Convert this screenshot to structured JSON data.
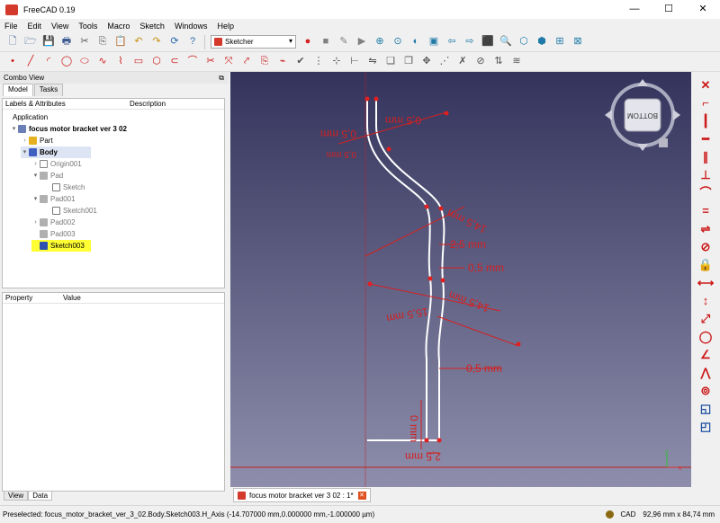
{
  "window": {
    "title": "FreeCAD 0.19",
    "minimize": "—",
    "maximize": "☐",
    "close": "✕"
  },
  "menu": [
    "File",
    "Edit",
    "View",
    "Tools",
    "Macro",
    "Sketch",
    "Windows",
    "Help"
  ],
  "workbench": {
    "selected": "Sketcher"
  },
  "toolbar1": {
    "icons_left": [
      "new-icon",
      "open-icon",
      "save-icon",
      "print-icon",
      "cut-icon",
      "copy-icon",
      "paste-icon",
      "undo-icon",
      "redo-icon",
      "refresh-icon",
      "whats-this-icon"
    ],
    "glyphs_left": [
      "🗋",
      "🗁",
      "💾",
      "🖶",
      "✂",
      "⎘",
      "📋",
      "↶",
      "↷",
      "⟳",
      "?"
    ],
    "icons_right": [
      "record-macro-icon",
      "stop-macro-icon",
      "edit-macro-icon",
      "run-macro-icon",
      "fit-all-icon",
      "fit-selection-icon",
      "draw-style-icon",
      "sync-view-icon",
      "back-icon",
      "forward-icon",
      "workbench-icon",
      "zoom-icon",
      "cube-view-icon",
      "part-icon",
      "measure-icon",
      "clipping-icon"
    ],
    "glyphs_right": [
      "●",
      "■",
      "✎",
      "▶",
      "⊕",
      "⊙",
      "◐",
      "▣",
      "⇦",
      "⇨",
      "⬛",
      "🔍",
      "⬡",
      "⬢",
      "⊞",
      "⊠"
    ]
  },
  "toolbar2": {
    "icons": [
      "point-icon",
      "line-icon",
      "arc-icon",
      "circle-icon",
      "conic-icon",
      "bspline-icon",
      "polyline-icon",
      "rectangle-icon",
      "polygon-icon",
      "slot-icon",
      "fillet-icon",
      "trim-icon",
      "extend-icon",
      "external-geometry-icon",
      "carbon-copy-icon",
      "construction-mode-icon",
      "validate-sketch-icon",
      "select-constraints-icon",
      "select-origin-icon",
      "select-axes-icon",
      "mirror-icon",
      "clone-icon",
      "copy-geometry-icon",
      "move-icon",
      "rectangular-array-icon",
      "delete-geometry-icon",
      "delete-constraints-icon",
      "toggle-driving-icon",
      "bspline-degree-icon"
    ],
    "glyphs": [
      "•",
      "╱",
      "◜",
      "◯",
      "⬭",
      "∿",
      "⌇",
      "▭",
      "⬡",
      "⊂",
      "⌒",
      "✂",
      "⤧",
      "⤤",
      "⎘",
      "⌁",
      "✔",
      "⋮",
      "⊹",
      "⊢",
      "⇋",
      "❏",
      "❐",
      "✥",
      "⋰",
      "✗",
      "⊘",
      "⇅",
      "≋"
    ]
  },
  "combo_view": {
    "header": "Combo View",
    "float_glyph": "⧉",
    "tabs": [
      "Model",
      "Tasks"
    ],
    "tree_columns": [
      "Labels & Attributes",
      "Description"
    ],
    "tree": [
      {
        "label": "Application",
        "arrow": "",
        "icon": "",
        "bold": false,
        "faded": false
      },
      {
        "label": "focus motor bracket ver 3 02",
        "arrow": "▾",
        "icon": "document-icon",
        "bold": true,
        "faded": false
      },
      {
        "label": "Part",
        "arrow": "›",
        "icon": "part-icon",
        "bold": false,
        "faded": false
      },
      {
        "label": "Body",
        "arrow": "▾",
        "icon": "body-icon",
        "bold": true,
        "faded": false,
        "highlight": true
      },
      {
        "label": "Origin001",
        "arrow": "›",
        "icon": "origin-icon",
        "bold": false,
        "faded": true
      },
      {
        "label": "Pad",
        "arrow": "▾",
        "icon": "pad-icon",
        "bold": false,
        "faded": true
      },
      {
        "label": "Sketch",
        "arrow": "",
        "icon": "sketch-icon",
        "bold": false,
        "faded": true
      },
      {
        "label": "Pad001",
        "arrow": "▾",
        "icon": "pad-icon",
        "bold": false,
        "faded": true
      },
      {
        "label": "Sketch001",
        "arrow": "",
        "icon": "sketch-icon",
        "bold": false,
        "faded": true
      },
      {
        "label": "Pad002",
        "arrow": "›",
        "icon": "pad-icon",
        "bold": false,
        "faded": true
      },
      {
        "label": "Pad003",
        "arrow": "",
        "icon": "pad-icon",
        "bold": false,
        "faded": true
      },
      {
        "label": "Sketch003",
        "arrow": "",
        "icon": "sketch-edit-icon",
        "bold": false,
        "faded": false,
        "selected": true
      }
    ],
    "property_columns": [
      "Property",
      "Value"
    ],
    "bottom_tabs": [
      "View",
      "Data"
    ]
  },
  "viewport": {
    "navcube_label": "BOTTOM",
    "dimensions": [
      "0,5 mm",
      "0,5 mm",
      "14,5 mm",
      "2,5 mm",
      "0,5 mm",
      "14,5 mm",
      "15,5 mm",
      "0,5 mm",
      "0 mm",
      "2,5 mm",
      "0,5 mm"
    ],
    "axis_labels": {
      "x": "x",
      "y": "y"
    }
  },
  "doc_tab": {
    "label": "focus motor bracket ver 3 02 : 1*",
    "close": "✕"
  },
  "right_toolbar": {
    "icons": [
      "coincident-icon",
      "point-on-object-icon",
      "vertical-icon",
      "horizontal-icon",
      "parallel-icon",
      "perpendicular-icon",
      "tangent-icon",
      "equal-icon",
      "symmetric-icon",
      "block-icon",
      "lock-icon",
      "horizontal-distance-icon",
      "vertical-distance-icon",
      "distance-icon",
      "radius-icon",
      "angle-icon",
      "snell-icon",
      "internal-alignment-icon",
      "toggle-constraint-icon",
      "toggle-active-icon"
    ],
    "glyphs": [
      "✕",
      "⌐",
      "┃",
      "━",
      "∥",
      "⊥",
      "⌒",
      "=",
      "⇌",
      "⊘",
      "🔒",
      "⟷",
      "↕",
      "⤢",
      "◯",
      "∠",
      "⋀",
      "⊚",
      "◱",
      "◰"
    ]
  },
  "status": {
    "preselected": "Preselected: focus_motor_bracket_ver_3_02.Body.Sketch003.H_Axis (-14.707000 mm,0.000000 mm,-1.000000 µm)",
    "nav_style": "CAD",
    "dimensions": "92,96 mm x 84,74 mm"
  }
}
